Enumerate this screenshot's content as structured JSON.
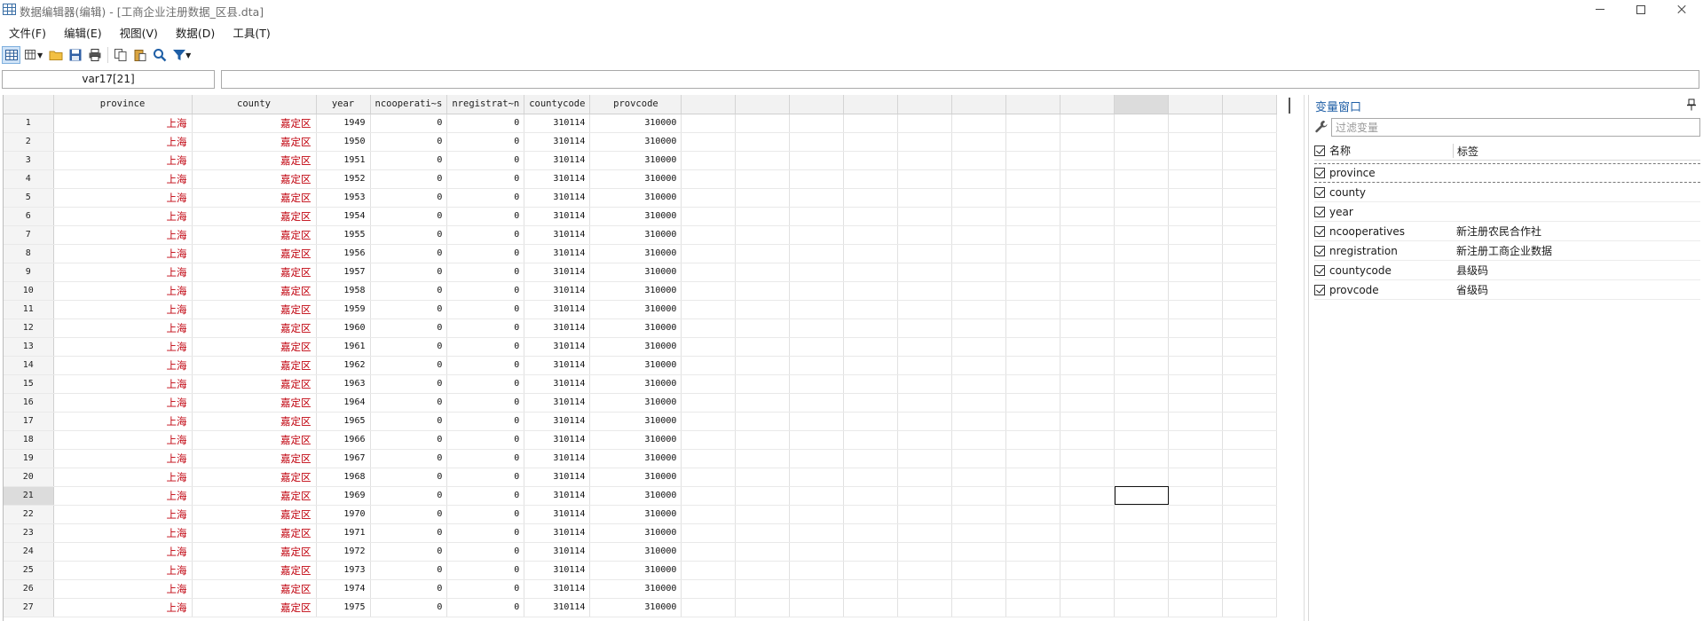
{
  "window": {
    "title": "数据编辑器(编辑) - [工商企业注册数据_区县.dta]"
  },
  "menu": [
    "文件(F)",
    "编辑(E)",
    "视图(V)",
    "数据(D)",
    "工具(T)"
  ],
  "toolbar": {
    "icons": [
      "data-editor-icon",
      "browse-view-icon",
      "open-folder-icon",
      "save-icon",
      "print-icon",
      "copy-icon",
      "paste-icon",
      "search-icon",
      "filter-icon"
    ]
  },
  "cell_ref": "var17[21]",
  "cell_content": "",
  "grid": {
    "columns": [
      "province",
      "county",
      "year",
      "ncooperati~s",
      "nregistrat~n",
      "countycode",
      "provcode"
    ],
    "empty_columns": 11,
    "selected_row": 21,
    "rows": [
      [
        "1",
        "上海",
        "嘉定区",
        "1949",
        "0",
        "0",
        "310114",
        "310000"
      ],
      [
        "2",
        "上海",
        "嘉定区",
        "1950",
        "0",
        "0",
        "310114",
        "310000"
      ],
      [
        "3",
        "上海",
        "嘉定区",
        "1951",
        "0",
        "0",
        "310114",
        "310000"
      ],
      [
        "4",
        "上海",
        "嘉定区",
        "1952",
        "0",
        "0",
        "310114",
        "310000"
      ],
      [
        "5",
        "上海",
        "嘉定区",
        "1953",
        "0",
        "0",
        "310114",
        "310000"
      ],
      [
        "6",
        "上海",
        "嘉定区",
        "1954",
        "0",
        "0",
        "310114",
        "310000"
      ],
      [
        "7",
        "上海",
        "嘉定区",
        "1955",
        "0",
        "0",
        "310114",
        "310000"
      ],
      [
        "8",
        "上海",
        "嘉定区",
        "1956",
        "0",
        "0",
        "310114",
        "310000"
      ],
      [
        "9",
        "上海",
        "嘉定区",
        "1957",
        "0",
        "0",
        "310114",
        "310000"
      ],
      [
        "10",
        "上海",
        "嘉定区",
        "1958",
        "0",
        "0",
        "310114",
        "310000"
      ],
      [
        "11",
        "上海",
        "嘉定区",
        "1959",
        "0",
        "0",
        "310114",
        "310000"
      ],
      [
        "12",
        "上海",
        "嘉定区",
        "1960",
        "0",
        "0",
        "310114",
        "310000"
      ],
      [
        "13",
        "上海",
        "嘉定区",
        "1961",
        "0",
        "0",
        "310114",
        "310000"
      ],
      [
        "14",
        "上海",
        "嘉定区",
        "1962",
        "0",
        "0",
        "310114",
        "310000"
      ],
      [
        "15",
        "上海",
        "嘉定区",
        "1963",
        "0",
        "0",
        "310114",
        "310000"
      ],
      [
        "16",
        "上海",
        "嘉定区",
        "1964",
        "0",
        "0",
        "310114",
        "310000"
      ],
      [
        "17",
        "上海",
        "嘉定区",
        "1965",
        "0",
        "0",
        "310114",
        "310000"
      ],
      [
        "18",
        "上海",
        "嘉定区",
        "1966",
        "0",
        "0",
        "310114",
        "310000"
      ],
      [
        "19",
        "上海",
        "嘉定区",
        "1967",
        "0",
        "0",
        "310114",
        "310000"
      ],
      [
        "20",
        "上海",
        "嘉定区",
        "1968",
        "0",
        "0",
        "310114",
        "310000"
      ],
      [
        "21",
        "上海",
        "嘉定区",
        "1969",
        "0",
        "0",
        "310114",
        "310000"
      ],
      [
        "22",
        "上海",
        "嘉定区",
        "1970",
        "0",
        "0",
        "310114",
        "310000"
      ],
      [
        "23",
        "上海",
        "嘉定区",
        "1971",
        "0",
        "0",
        "310114",
        "310000"
      ],
      [
        "24",
        "上海",
        "嘉定区",
        "1972",
        "0",
        "0",
        "310114",
        "310000"
      ],
      [
        "25",
        "上海",
        "嘉定区",
        "1973",
        "0",
        "0",
        "310114",
        "310000"
      ],
      [
        "26",
        "上海",
        "嘉定区",
        "1974",
        "0",
        "0",
        "310114",
        "310000"
      ],
      [
        "27",
        "上海",
        "嘉定区",
        "1975",
        "0",
        "0",
        "310114",
        "310000"
      ]
    ]
  },
  "variables_panel": {
    "title": "变量窗口",
    "filter_placeholder": "过滤变量",
    "header_name": "名称",
    "header_label": "标签",
    "variables": [
      {
        "name": "province",
        "label": ""
      },
      {
        "name": "county",
        "label": ""
      },
      {
        "name": "year",
        "label": ""
      },
      {
        "name": "ncooperatives",
        "label": "新注册农民合作社"
      },
      {
        "name": "nregistration",
        "label": "新注册工商企业数据"
      },
      {
        "name": "countycode",
        "label": "县级码"
      },
      {
        "name": "provcode",
        "label": "省级码"
      }
    ]
  },
  "colors": {
    "string_text": "#c0000c",
    "panel_title": "#1f5fa6"
  }
}
